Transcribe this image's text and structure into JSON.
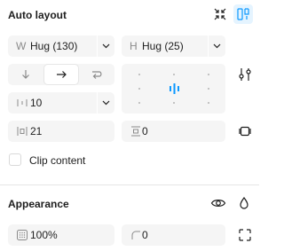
{
  "auto_layout": {
    "title": "Auto layout",
    "width": {
      "prefix": "W",
      "value": "Hug (130)"
    },
    "height": {
      "prefix": "H",
      "value": "Hug (25)"
    },
    "gap": {
      "value": "10"
    },
    "padding": {
      "value": "21"
    },
    "padding_vertical": {
      "value": "0"
    },
    "clip_content_label": "Clip content",
    "clip_content_checked": false,
    "direction_selected": "horizontal"
  },
  "appearance": {
    "title": "Appearance",
    "opacity": {
      "value": "100%"
    },
    "corner_radius": {
      "value": "0"
    }
  },
  "colors": {
    "accent": "#0d99ff",
    "alignment_bars": "#0d99ff",
    "field_bg": "#f5f5f5",
    "icon_gray": "#8a8a8a"
  }
}
